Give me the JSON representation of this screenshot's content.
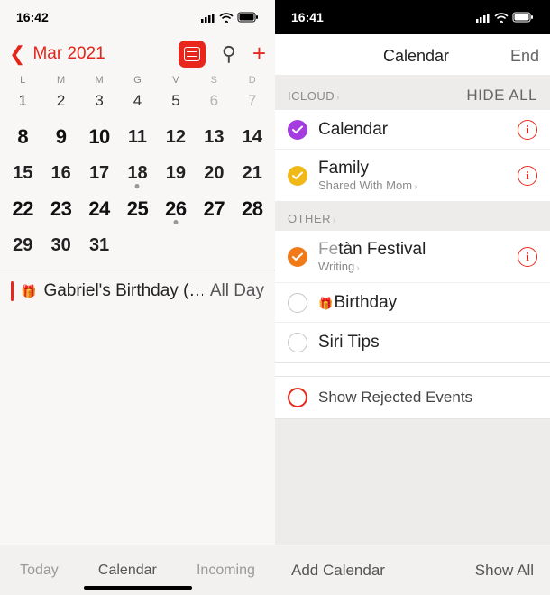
{
  "left": {
    "status_time": "16:42",
    "back_label": "Mar 2021",
    "weekdays": [
      "L",
      "M",
      "M",
      "G",
      "V",
      "S",
      "D"
    ],
    "days": [
      [
        {
          "n": "1"
        },
        {
          "n": "2"
        },
        {
          "n": "3"
        },
        {
          "n": "4"
        },
        {
          "n": "5"
        },
        {
          "n": "6",
          "wknd": true
        },
        {
          "n": "7",
          "wknd": true
        }
      ],
      [
        {
          "n": "8",
          "bold": true
        },
        {
          "n": "9",
          "bold": true
        },
        {
          "n": "10",
          "bold": true
        },
        {
          "n": "11",
          "wknd": true,
          "mid": true
        },
        {
          "n": "12",
          "wknd": true,
          "mid": true
        },
        {
          "n": "13",
          "wknd": true,
          "mid": true
        },
        {
          "n": "14",
          "wknd": true,
          "mid": true
        }
      ],
      [
        {
          "n": "15",
          "mid": true
        },
        {
          "n": "16",
          "mid": true
        },
        {
          "n": "17",
          "mid": true
        },
        {
          "n": "18",
          "mid": true,
          "marked": true
        },
        {
          "n": "19",
          "wknd": true,
          "mid": true
        },
        {
          "n": "20",
          "wknd": true,
          "mid": true
        },
        {
          "n": "21",
          "wknd": true,
          "mid": true
        }
      ],
      [
        {
          "n": "22",
          "bold": true
        },
        {
          "n": "23",
          "bold": true
        },
        {
          "n": "24",
          "bold": true
        },
        {
          "n": "25",
          "bold": true
        },
        {
          "n": "26",
          "bold": true,
          "marked": true
        },
        {
          "n": "27",
          "bold": true,
          "wknd": false
        },
        {
          "n": "28",
          "bold": true
        }
      ],
      [
        {
          "n": "29",
          "mid": true
        },
        {
          "n": "30",
          "mid": true
        },
        {
          "n": "31",
          "mid": true
        },
        {
          "n": ""
        },
        {
          "n": ""
        },
        {
          "n": ""
        },
        {
          "n": ""
        }
      ]
    ],
    "event_title": "Gabriel's Birthday (…",
    "event_time": "All Day",
    "toolbar": {
      "today": "Today",
      "calendar": "Calendar",
      "incoming": "Incoming"
    }
  },
  "right": {
    "status_time": "16:41",
    "nav_title": "Calendar",
    "nav_end": "End",
    "section_icloud": "ICLOUD",
    "hide_all": "HIDE ALL",
    "section_other": "OTHER",
    "items_icloud": [
      {
        "name": "Calendar",
        "color": "purple",
        "checked": true,
        "info": true
      },
      {
        "name": "Family",
        "sub": "Shared With Mom",
        "color": "yellow",
        "checked": true,
        "info": true
      }
    ],
    "items_other": [
      {
        "name": "tàn Festival",
        "prefix": "Fe",
        "sub": "Writing",
        "color": "orange",
        "checked": true,
        "info": true
      },
      {
        "name": "Birthday",
        "bday": true,
        "checked": false
      },
      {
        "name": "Siri Tips",
        "checked": false
      }
    ],
    "rejected": "Show Rejected Events",
    "toolbar": {
      "add": "Add Calendar",
      "show": "Show All"
    }
  }
}
